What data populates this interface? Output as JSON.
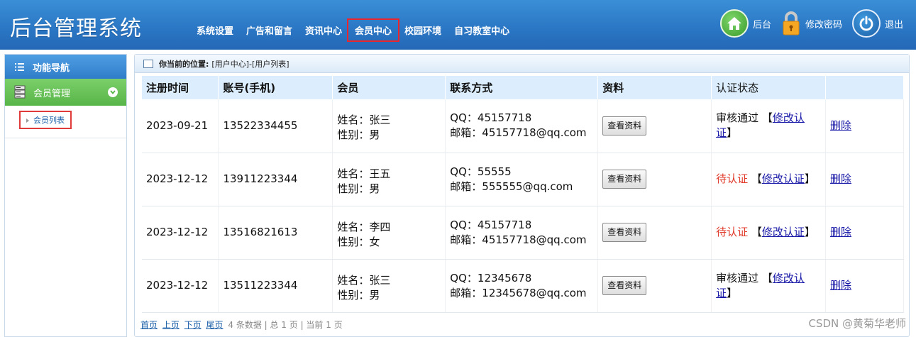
{
  "app_title": "后台管理系统",
  "nav": [
    "系统设置",
    "广告和留言",
    "资讯中心",
    "会员中心",
    "校园环境",
    "自习教室中心"
  ],
  "tools": {
    "home": "后台",
    "password": "修改密码",
    "logout": "退出"
  },
  "sidebar": {
    "title": "功能导航",
    "group": "会员管理",
    "item": "会员列表"
  },
  "breadcrumb": {
    "label": "你当前的位置:",
    "path": "[用户中心]-[用户列表]"
  },
  "table": {
    "headers": [
      "注册时间",
      "账号(手机)",
      "会员",
      "联系方式",
      "资料",
      "认证状态",
      ""
    ],
    "rows": [
      {
        "date": "2023-09-21",
        "phone": "13522334455",
        "name": "姓名：张三",
        "gender": "性别：男",
        "qq": "QQ：45157718",
        "email": "邮箱：45157718@qq.com",
        "status": "审核通过",
        "pending": false
      },
      {
        "date": "2023-12-12",
        "phone": "13911223344",
        "name": "姓名：王五",
        "gender": "性别：男",
        "qq": "QQ：55555",
        "email": "邮箱：555555@qq.com",
        "status": "待认证",
        "pending": true
      },
      {
        "date": "2023-12-12",
        "phone": "13516821613",
        "name": "姓名：李四",
        "gender": "性别：女",
        "qq": "QQ：45157718",
        "email": "邮箱：45157718@qq.com",
        "status": "待认证",
        "pending": true
      },
      {
        "date": "2023-12-12",
        "phone": "13511223344",
        "name": "姓名：张三",
        "gender": "性别：男",
        "qq": "QQ：12345678",
        "email": "邮箱：12345678@qq.com",
        "status": "审核通过",
        "pending": false
      }
    ],
    "view_btn": "查看资料",
    "edit_link": "修改认证",
    "delete_link": "删除"
  },
  "pager": {
    "first": "首页",
    "prev": "上页",
    "next": "下页",
    "last": "尾页",
    "info": "4 条数据 | 总 1 页 | 当前 1 页"
  },
  "watermark": "CSDN @黄菊华老师",
  "colors": {
    "header": "#2a76c4",
    "sidebar_group": "#58b548",
    "pending": "#e03a2a",
    "link": "#1a1aa8"
  }
}
